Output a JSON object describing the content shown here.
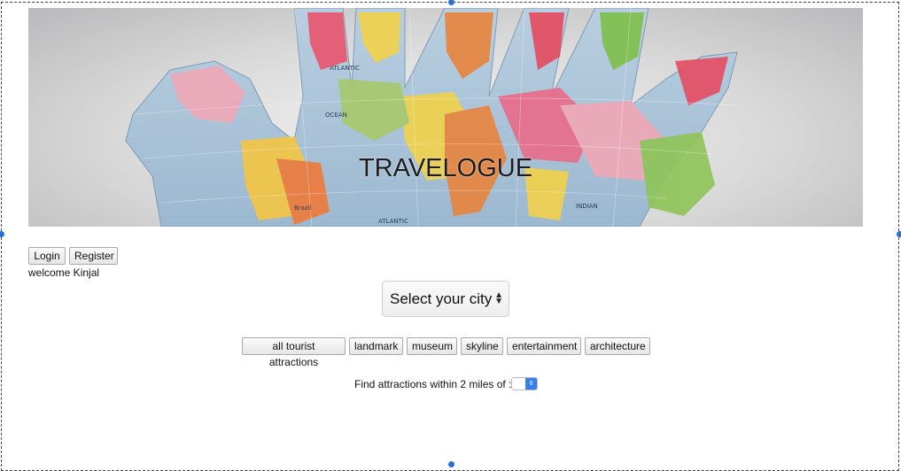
{
  "banner": {
    "title": "TRAVELOGUE",
    "map_labels": [
      "ATLANTIC",
      "OCEAN",
      "ATLANTIC",
      "INDIAN",
      "ATLANTIC",
      "Brazil"
    ]
  },
  "auth": {
    "login_label": "Login",
    "register_label": "Register",
    "welcome_text": "welcome Kinjal"
  },
  "city_select": {
    "selected": "Select your city"
  },
  "categories": [
    "all tourist attractions",
    "landmark",
    "museum",
    "skyline",
    "entertainment",
    "architecture"
  ],
  "distance": {
    "label": "Find attractions within 2 miles of :",
    "value": ""
  },
  "colors": {
    "selection_handle": "#2b6fd6",
    "stepper": "#3a7ee8"
  }
}
